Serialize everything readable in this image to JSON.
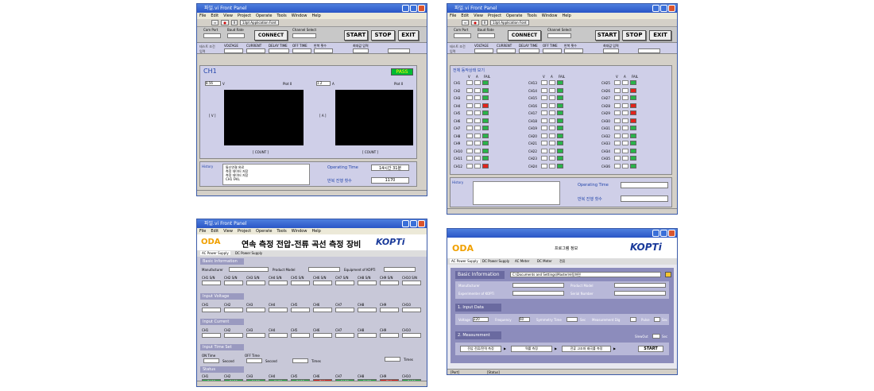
{
  "w1": {
    "title": "파일.vi Front Panel",
    "menu": [
      "File",
      "Edit",
      "View",
      "Project",
      "Operate",
      "Tools",
      "Window",
      "Help"
    ],
    "app_font": "13pt Application Font",
    "com_port": "Com Port",
    "baud": "Baud Rate",
    "connect": "CONNECT",
    "ch_select": "Channel Select",
    "start": "START",
    "stop": "STOP",
    "exit": "EXIT",
    "cond_label": "테스트 조건 입력",
    "fields": [
      "VOLTAGE",
      "CURRENT",
      "DELAY TIME",
      "OFF TIME",
      "반복 횟수",
      "최대값 입력"
    ],
    "ch": "CH1",
    "pass": "PASS",
    "v_val": "8.56",
    "v_unit": "V",
    "a_val": "1.2",
    "a_unit": "A",
    "plot": "Plot 0",
    "xlabel": "[ COUNT ]",
    "yl1": "[ V ]",
    "yl2": "[ A ]",
    "yticks": [
      "15",
      "10",
      "5",
      "0",
      "-5",
      "-10",
      "-15",
      "-20",
      "-25",
      "-30"
    ],
    "x0": "0",
    "x1": "100",
    "history_label": "History",
    "history": [
      "통신연결 완료",
      "측정 데이터 저장",
      "측정 데이터 저장",
      "CH1 FAIL"
    ],
    "op_time_label": "Operating Time",
    "op_time": "14시간 31분",
    "count_label": "반복 진행 횟수",
    "count": "1170"
  },
  "w2": {
    "title": "파일.vi Front Panel",
    "sec": "전체 동작상태 보기",
    "headers": [
      "V",
      "A",
      "FAIL"
    ],
    "col1": [
      "CH1",
      "CH2",
      "CH3",
      "CH4",
      "CH5",
      "CH6",
      "CH7",
      "CH8",
      "CH9",
      "CH10",
      "CH11",
      "CH12"
    ],
    "col2": [
      "CH13",
      "CH14",
      "CH15",
      "CH16",
      "CH17",
      "CH18",
      "CH19",
      "CH20",
      "CH21",
      "CH22",
      "CH23",
      "CH24"
    ],
    "col3": [
      "CH25",
      "CH26",
      "CH27",
      "CH28",
      "CH29",
      "CH30",
      "CH31",
      "CH32",
      "CH33",
      "CH34",
      "CH35",
      "CH36"
    ],
    "history_label": "History",
    "op_time_label": "Operating Time",
    "count_label": "반복 진행 횟수"
  },
  "w3": {
    "title": "파일.vi Front Panel",
    "logo": "ODA",
    "heading": "연속 측정 전압-전류 곡선 측정 장비",
    "kopti": "KOPTi",
    "tabs": [
      "AC Power Supply",
      "DC Power Supply"
    ],
    "basic": "Basic Information",
    "manufacturer": "Manufacturer",
    "model": "Product Model",
    "equip": "Equipment of KOPTi",
    "sn": [
      "CH1 S/N",
      "CH2 S/N",
      "CH3 S/N",
      "CH4 S/N",
      "CH5 S/N",
      "CH6 S/N",
      "CH7 S/N",
      "CH8 S/N",
      "CH9 S/N",
      "CH10 S/N"
    ],
    "input_v": "Input Voltage",
    "input_c": "Input Current",
    "chs": [
      "CH1",
      "CH2",
      "CH3",
      "CH4",
      "CH5",
      "CH6",
      "CH7",
      "CH8",
      "CH9",
      "CH10"
    ],
    "timeset": "Input Time Set",
    "on_time": "ON Time",
    "off_time": "OFF Time",
    "second": "Second",
    "times": "Times",
    "status": "Status",
    "pass": "PASS",
    "fail": "FAIL"
  },
  "w4": {
    "logo": "ODA",
    "prog": "프로그램 정보",
    "kopti": "KOPTi",
    "tabs": [
      "AC Power Supply",
      "DC Power Supply",
      "AC Meter",
      "DC Meter",
      "전류"
    ],
    "basic": "Basic Information",
    "path": "C:\\Documents and Settings\\Master\\바탕화면",
    "manufacturer": "Manufacturer",
    "model": "Product Model",
    "exp": "Experimenter of KOPTi",
    "serial": "Serial Number",
    "input": "1. Input Data",
    "voltage": "Voltage",
    "vval": "220",
    "freq": "Frequency",
    "fval": "60",
    "sym": "Symmetry Time",
    "sec": "Sec",
    "mdig": "Measurement Dig",
    "pulse": "Pulse",
    "meas": "2. Measurement",
    "slew": "SlewOut",
    "steps": [
      "전압 전류/전력 측정",
      "역률 측정",
      "전류 고조파 왜곡률 측정"
    ],
    "start": "START",
    "stat1": "[Port]",
    "stat2": "[Status]"
  }
}
